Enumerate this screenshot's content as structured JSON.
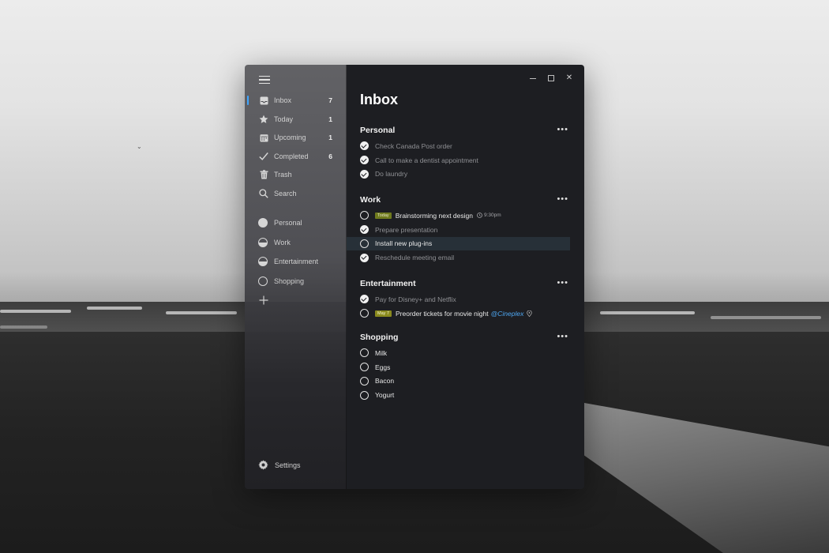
{
  "window": {
    "title": "Inbox",
    "controls": [
      "minimize",
      "maximize",
      "close"
    ]
  },
  "sidebar": {
    "nav": [
      {
        "label": "Inbox",
        "count": "7",
        "icon": "inbox-icon",
        "active": true
      },
      {
        "label": "Today",
        "count": "1",
        "icon": "star-icon"
      },
      {
        "label": "Upcoming",
        "count": "1",
        "icon": "calendar-icon"
      },
      {
        "label": "Completed",
        "count": "6",
        "icon": "checkmark-icon"
      },
      {
        "label": "Trash",
        "count": "",
        "icon": "trash-icon"
      },
      {
        "label": "Search",
        "count": "",
        "icon": "search-icon"
      }
    ],
    "lists": [
      {
        "label": "Personal",
        "icon": "circle-full-icon"
      },
      {
        "label": "Work",
        "icon": "circle-half-icon"
      },
      {
        "label": "Entertainment",
        "icon": "circle-half-icon"
      },
      {
        "label": "Shopping",
        "icon": "circle-empty-icon"
      }
    ],
    "settings_label": "Settings"
  },
  "sections": [
    {
      "name": "Personal",
      "tasks": [
        {
          "text": "Check Canada Post order",
          "done": true
        },
        {
          "text": "Call to make a dentist appointment",
          "done": true
        },
        {
          "text": "Do laundry",
          "done": true
        }
      ]
    },
    {
      "name": "Work",
      "tasks": [
        {
          "text": "Brainstorming next design",
          "done": false,
          "tag": "Today",
          "time": "9:30pm"
        },
        {
          "text": "Prepare presentation",
          "done": true
        },
        {
          "text": "Install new plug-ins",
          "done": false,
          "highlighted": true
        },
        {
          "text": "Reschedule meeting email",
          "done": true
        }
      ]
    },
    {
      "name": "Entertainment",
      "tasks": [
        {
          "text": "Pay for Disney+ and Netflix",
          "done": true
        },
        {
          "text": "Preorder tickets for movie night",
          "done": false,
          "tag": "May 7",
          "mention": "@Cineplex",
          "location_icon": "location-pin-icon"
        }
      ]
    },
    {
      "name": "Shopping",
      "tasks": [
        {
          "text": "Milk",
          "done": false
        },
        {
          "text": "Eggs",
          "done": false
        },
        {
          "text": "Bacon",
          "done": false
        },
        {
          "text": "Yogurt",
          "done": false
        }
      ]
    }
  ],
  "more_label": "•••",
  "colors": {
    "accent": "#3fa6ff",
    "mention": "#4ea7f2",
    "tag_today": "#6f7a1d",
    "main_bg": "#1d1e22",
    "highlight_row": "#273038"
  }
}
